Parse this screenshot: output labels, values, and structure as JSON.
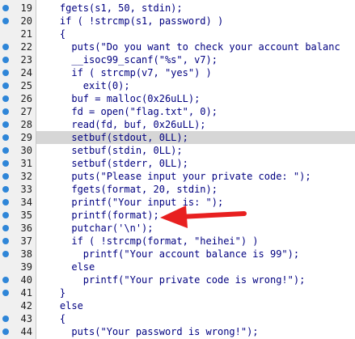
{
  "editor": {
    "accent_breakpoint": "#2f86d8",
    "highlight_color": "#d6d6d6",
    "code_color": "#000080",
    "annotation_color": "#e82020",
    "lines": [
      {
        "num": "19",
        "code": "    fgets(s1, 50, stdin);"
      },
      {
        "num": "20",
        "code": "    if ( !strcmp(s1, password) )"
      },
      {
        "num": "21",
        "code": "    {"
      },
      {
        "num": "22",
        "code": "      puts(\"Do you want to check your account balanc"
      },
      {
        "num": "23",
        "code": "      __isoc99_scanf(\"%s\", v7);"
      },
      {
        "num": "24",
        "code": "      if ( strcmp(v7, \"yes\") )"
      },
      {
        "num": "25",
        "code": "        exit(0);"
      },
      {
        "num": "26",
        "code": "      buf = malloc(0x26uLL);"
      },
      {
        "num": "27",
        "code": "      fd = open(\"flag.txt\", 0);"
      },
      {
        "num": "28",
        "code": "      read(fd, buf, 0x26uLL);"
      },
      {
        "num": "29",
        "code": "      setbuf(stdout, 0LL);"
      },
      {
        "num": "30",
        "code": "      setbuf(stdin, 0LL);"
      },
      {
        "num": "31",
        "code": "      setbuf(stderr, 0LL);"
      },
      {
        "num": "32",
        "code": "      puts(\"Please input your private code: \");"
      },
      {
        "num": "33",
        "code": "      fgets(format, 20, stdin);"
      },
      {
        "num": "34",
        "code": "      printf(\"Your input is: \");"
      },
      {
        "num": "35",
        "code": "      printf(format);"
      },
      {
        "num": "36",
        "code": "      putchar('\\n');"
      },
      {
        "num": "37",
        "code": "      if ( !strcmp(format, \"heihei\") )"
      },
      {
        "num": "38",
        "code": "        printf(\"Your account balance is 99\");"
      },
      {
        "num": "39",
        "code": "      else"
      },
      {
        "num": "40",
        "code": "        printf(\"Your private code is wrong!\");"
      },
      {
        "num": "41",
        "code": "    }"
      },
      {
        "num": "42",
        "code": "    else"
      },
      {
        "num": "43",
        "code": "    {"
      },
      {
        "num": "44",
        "code": "      puts(\"Your password is wrong!\");"
      }
    ]
  }
}
